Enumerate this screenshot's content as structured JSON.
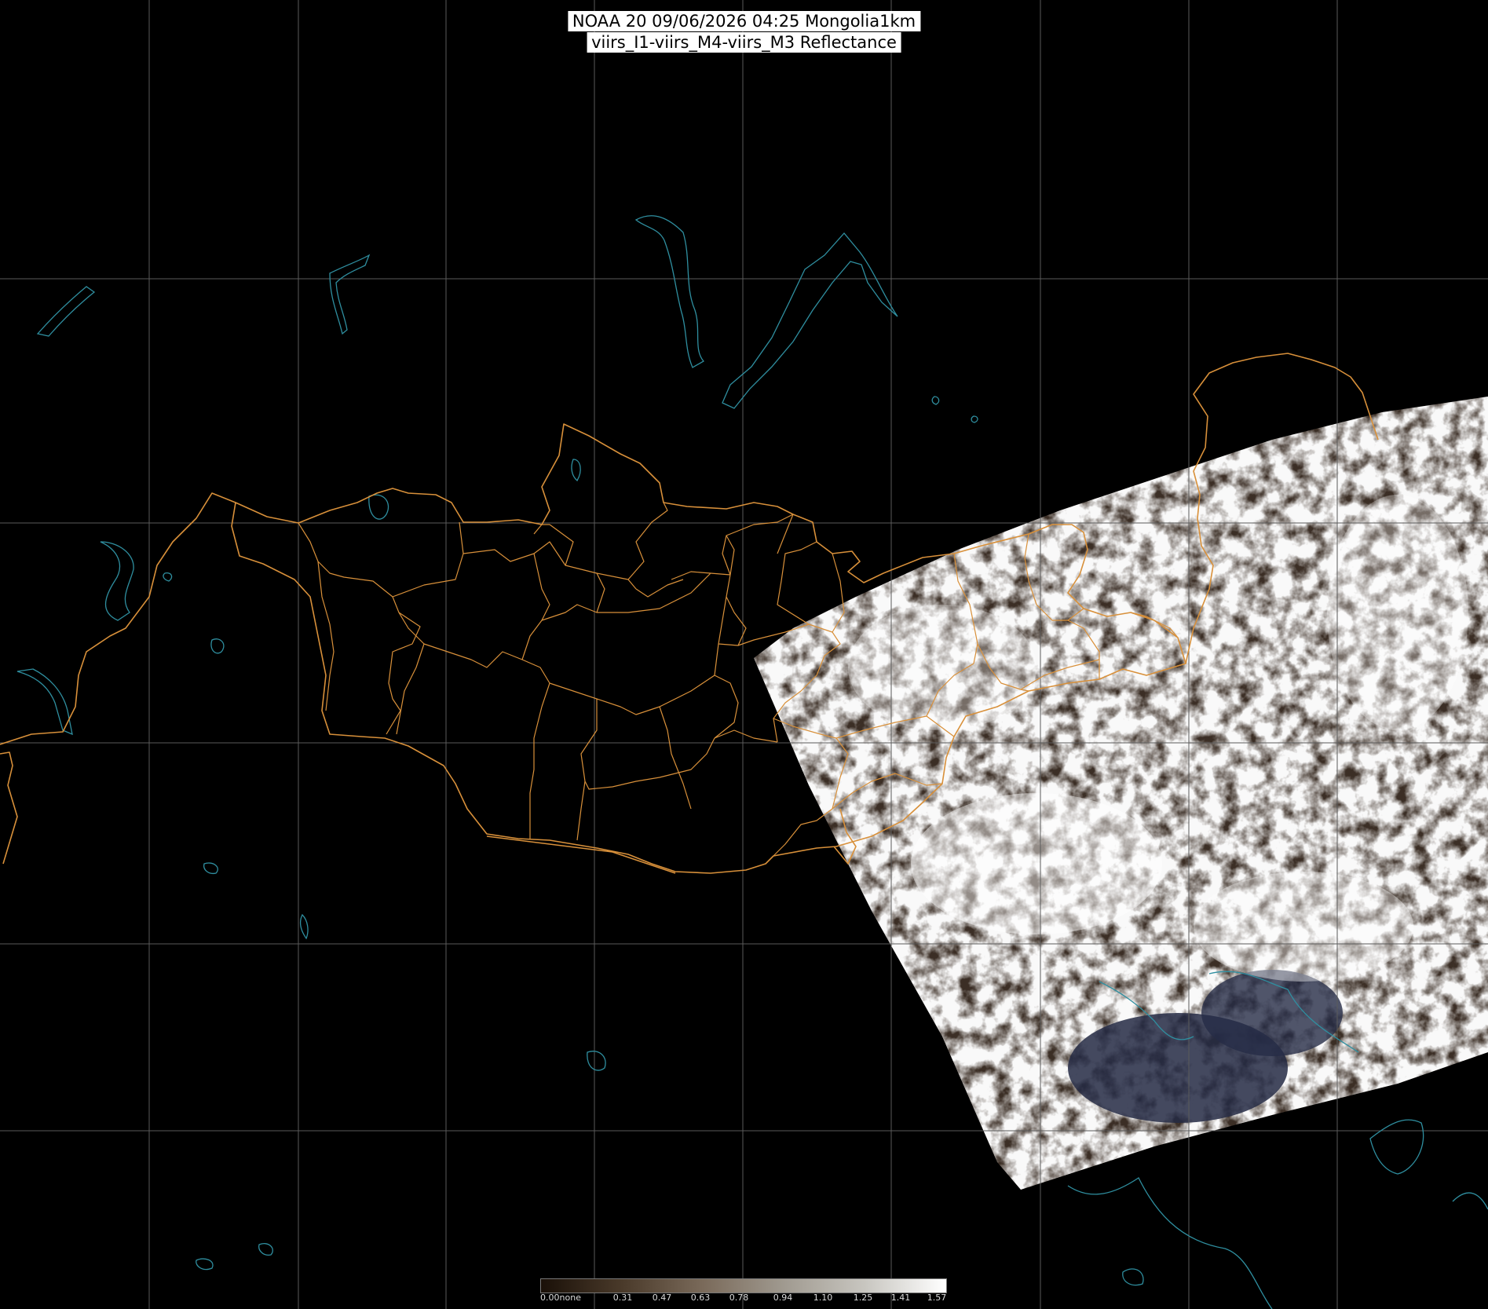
{
  "header": {
    "line1": "NOAA 20 09/06/2026 04:25 Mongolia1km",
    "line2": "viirs_I1-viirs_M4-viirs_M3 Reflectance"
  },
  "colorbar": {
    "labels": [
      "0.00none",
      "0.31",
      "0.47",
      "0.63",
      "0.78",
      "0.94",
      "1.10",
      "1.25",
      "1.41",
      "1.57"
    ],
    "colors": [
      "#1a1008",
      "#4a3a2a",
      "#7a6a5a",
      "#a09a90",
      "#c8c6c0",
      "#ffffff"
    ]
  },
  "colors": {
    "background": "#000000",
    "graticule": "#5a5a5a",
    "borders": "#d8903a",
    "coast": "#2f8fa0"
  }
}
